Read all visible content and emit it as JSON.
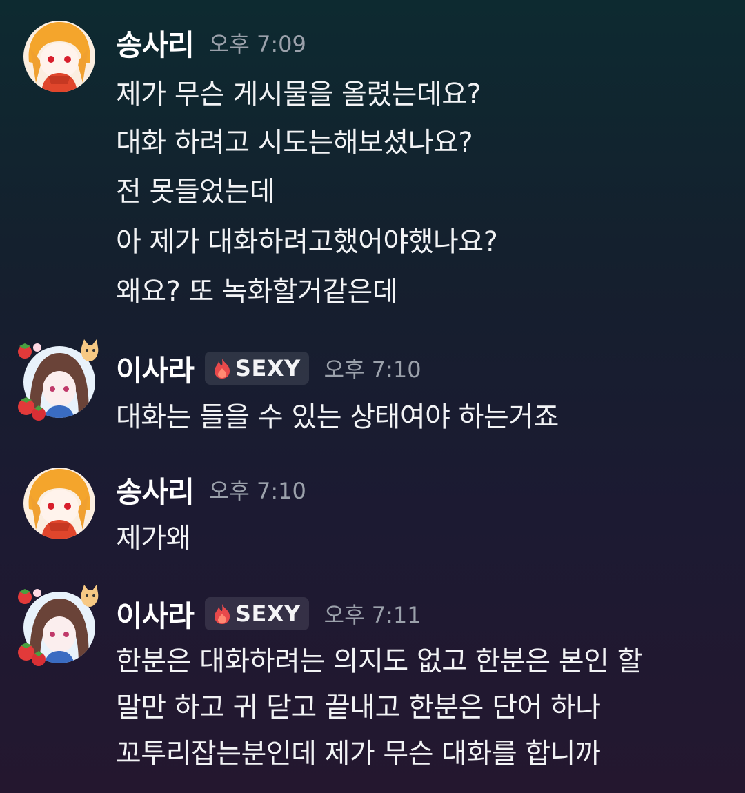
{
  "colors": {
    "username": "#ffffff",
    "timestamp": "#9ba1ab",
    "message_text": "#f2f3f5",
    "tag_background": "#2f2f3d",
    "tag_icon": "#e8494b"
  },
  "messages": [
    {
      "author": "송사리",
      "avatar_icon": "orange-haired-character-avatar",
      "time": "오후 7:09",
      "lines": [
        "제가 무슨 게시물을 올렸는데요?",
        "대화 하려고 시도는해보셨나요?",
        "전 못들었는데",
        "아 제가 대화하려고했어야했나요?",
        "왜요? 또 녹화할거같은데"
      ]
    },
    {
      "author": "이사라",
      "avatar_icon": "brown-haired-character-avatar-with-strawberries",
      "tag": {
        "icon": "flame-icon",
        "label": "SEXY"
      },
      "time": "오후 7:10",
      "lines": [
        "대화는 들을 수 있는 상태여야 하는거죠"
      ]
    },
    {
      "author": "송사리",
      "avatar_icon": "orange-haired-character-avatar",
      "time": "오후 7:10",
      "lines": [
        "제가왜"
      ]
    },
    {
      "author": "이사라",
      "avatar_icon": "brown-haired-character-avatar-with-strawberries",
      "tag": {
        "icon": "flame-icon",
        "label": "SEXY"
      },
      "time": "오후 7:11",
      "lines": [
        "한분은 대화하려는 의지도 없고 한분은 본인 할",
        "말만 하고 귀 닫고 끝내고 한분은 단어 하나",
        "꼬투리잡는분인데 제가 무슨 대화를 합니까"
      ]
    }
  ]
}
